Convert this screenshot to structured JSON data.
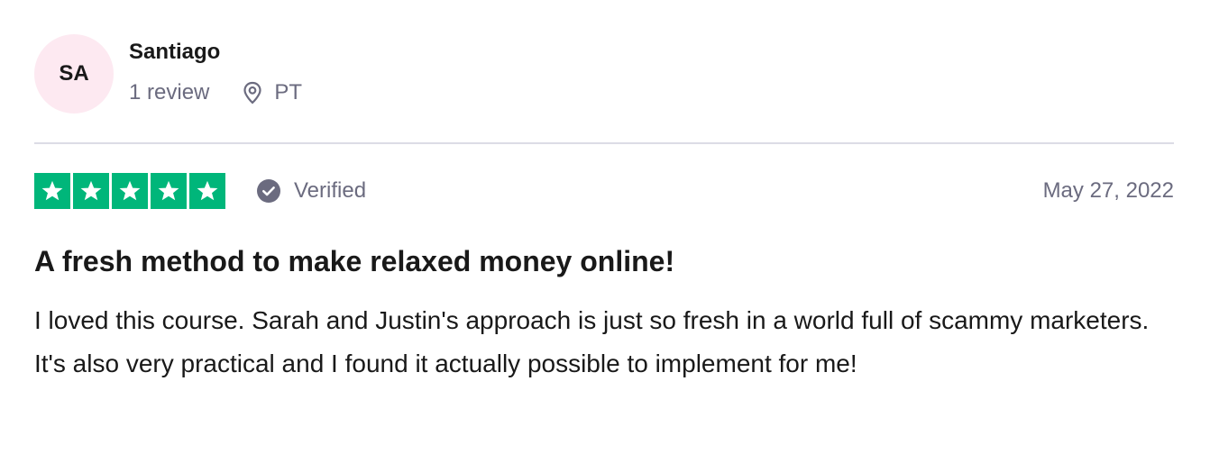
{
  "consumer": {
    "initials": "SA",
    "name": "Santiago",
    "review_count": "1 review",
    "location": "PT",
    "avatar_color": "#fde9f1",
    "location_icon": "location-pin-icon"
  },
  "review": {
    "rating": 5,
    "max_rating": 5,
    "star_color": "#00b67a",
    "verified_label": "Verified",
    "verified_icon": "check-circle-icon",
    "date": "May 27, 2022",
    "title": "A fresh method to make relaxed money online!",
    "body": "I loved this course. Sarah and Justin's approach is just so fresh in a world full of scammy marketers. It's also very practical and I found it actually possible to implement for me!"
  }
}
